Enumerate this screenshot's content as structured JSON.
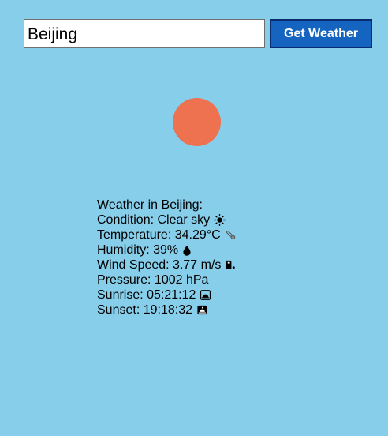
{
  "search": {
    "value": "Beijing",
    "button_label": "Get Weather"
  },
  "colors": {
    "background": "#87ceeb",
    "sun": "#ee7150",
    "button": "#1565c0"
  },
  "weather": {
    "heading": "Weather in Beijing:",
    "condition": "Condition: Clear sky",
    "condition_icon": "sun-icon",
    "temperature": "Temperature: 34.29°C",
    "temperature_icon": "thermometer-icon",
    "humidity": "Humidity: 39%",
    "humidity_icon": "droplet-icon",
    "wind_speed": "Wind Speed: 3.77 m/s",
    "wind_icon": "wind-icon",
    "pressure": "Pressure: 1002 hPa",
    "sunrise": "Sunrise: 05:21:12",
    "sunrise_icon": "sunrise-icon",
    "sunset": "Sunset: 19:18:32",
    "sunset_icon": "sunset-icon"
  }
}
